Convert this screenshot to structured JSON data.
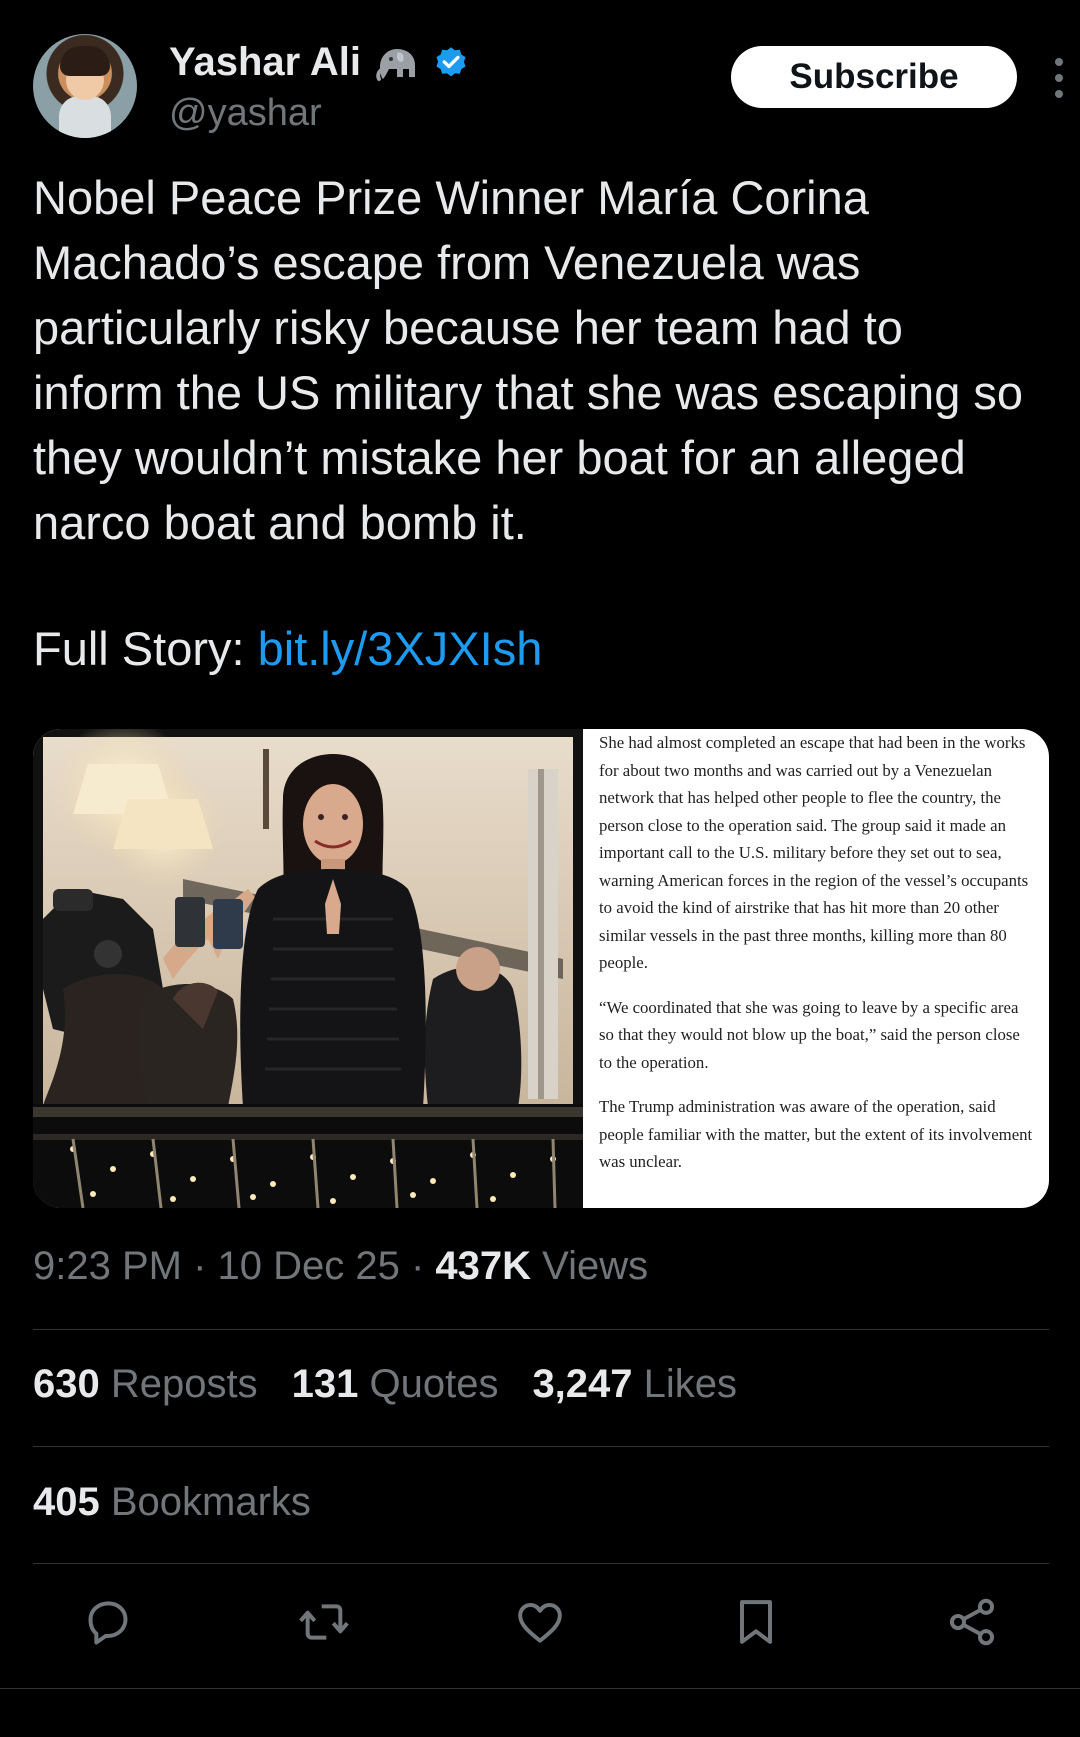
{
  "author": {
    "display_name": "Yashar Ali",
    "handle": "@yashar",
    "verified": true
  },
  "subscribe_label": "Subscribe",
  "tweet": {
    "text": "Nobel Peace Prize Winner María Corina Machado’s escape from Venezuela was particularly risky because her team had to inform the US military that she was escaping so they wouldn’t mistake her boat for an alleged narco boat and bomb it.",
    "full_story_label": "Full Story: ",
    "link": "bit.ly/3XJXIsh"
  },
  "article": {
    "paragraphs": [
      "She had almost completed an escape that had been in the works for about two months and was carried out by a Venezuelan network that has helped other people to flee the country, the person close to the operation said. The group said it made an important call to the U.S. military before they set out to sea, warning American forces in the region of the vessel’s occupants to avoid the kind of airstrike that has hit more than 20 other similar vessels in the past three months, killing more than 80 people.",
      "“We coordinated that she was going to leave by a specific area so that they would not blow up the boat,” said the person close to the operation.",
      "The Trump administration was aware of the operation, said people familiar with the matter, but the extent of its involvement was unclear."
    ]
  },
  "meta": {
    "time": "9:23 PM",
    "sep1": " · ",
    "date": "10 Dec 25",
    "sep2": " · ",
    "views_count": "437K",
    "views_label": " Views"
  },
  "stats": {
    "reposts_count": "630",
    "reposts_label": " Reposts",
    "quotes_count": "131",
    "quotes_label": " Quotes",
    "likes_count": "3,247",
    "likes_label": " Likes",
    "bookmarks_count": "405",
    "bookmarks_label": " Bookmarks"
  },
  "colors": {
    "background": "#000000",
    "text": "#e7e9ea",
    "muted": "#71767b",
    "link": "#1d9bf0",
    "verified": "#1d9bf0",
    "divider": "#2f3336"
  },
  "icons": [
    "elephant-emoji",
    "verified-badge-icon",
    "more-options-icon",
    "reply-icon",
    "repost-icon",
    "like-icon",
    "bookmark-icon",
    "share-icon"
  ]
}
